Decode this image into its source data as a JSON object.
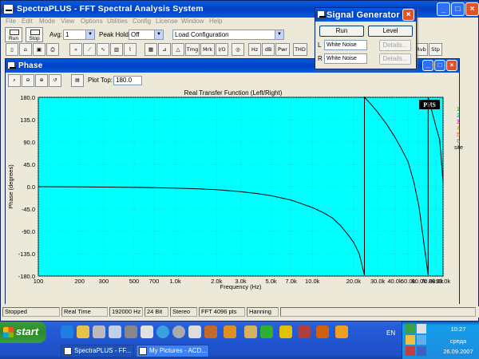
{
  "main_window": {
    "title": "SpectraPLUS - FFT Spectral Analysis System",
    "menu": [
      "File",
      "Edit",
      "Mode",
      "View",
      "Options",
      "Utilities",
      "Config",
      "License",
      "Window",
      "Help"
    ],
    "toolbar": {
      "run_label": "Run",
      "stop_label": "Stop",
      "avg_label": "Avg:",
      "avg_value": "1",
      "peak_hold_label": "Peak Hold:",
      "peak_hold_value": "Off",
      "config_value": "Load Configuration",
      "row2_buttons": [
        "Tmg",
        "Mrk",
        "I/O",
        "Hz",
        "dB",
        "Pwr",
        "THD",
        "Rvb",
        "Stp"
      ]
    }
  },
  "signal_generator": {
    "title": "Signal Generator",
    "run_label": "Run",
    "level_label": "Level",
    "left_channel_label": "L",
    "right_channel_label": "R",
    "left_signal": "White Noise",
    "right_signal": "White Noise",
    "details_label": "Details..."
  },
  "phase_window": {
    "title": "Phase",
    "plot_top_label": "Plot Top:",
    "plot_top_value": "180.0",
    "legend": {
      "numbers": [
        "1",
        "2",
        "3",
        "4",
        "5",
        "6"
      ],
      "colors": [
        "#00a000",
        "#00a0a0",
        "#a000a0",
        "#d0a000",
        "#d06000",
        "#808080"
      ],
      "trailing_text": "site"
    }
  },
  "chart_data": {
    "type": "line",
    "title": "Real Transfer Function (Left/Right)",
    "xlabel": "Frequency (Hz)",
    "ylabel": "Phase (degrees)",
    "xscale": "log",
    "xlim": [
      100,
      90000
    ],
    "ylim": [
      -180,
      180
    ],
    "x_tick_labels": [
      "100",
      "200",
      "300",
      "500",
      "700",
      "1.0k",
      "2.0k",
      "3.0k",
      "5.0k",
      "7.0k",
      "10.0k",
      "20.0k",
      "30.0k",
      "40.0k",
      "60.0k",
      "80.0k",
      "50.0k",
      "70.0k",
      "90.0k"
    ],
    "x_tick_values": [
      100,
      200,
      300,
      500,
      700,
      1000,
      2000,
      3000,
      5000,
      7000,
      10000,
      20000,
      30000,
      40000,
      60000,
      80000,
      50000,
      70000,
      90000
    ],
    "y_tick_labels": [
      "180.0",
      "135.0",
      "90.0",
      "45.0",
      "0.0",
      "-45.0",
      "-90.0",
      "-135.0",
      "-180.0"
    ],
    "y_tick_values": [
      180,
      135,
      90,
      45,
      0,
      -45,
      -90,
      -135,
      -180
    ],
    "grid": true,
    "background": "#00ffff",
    "logo_text": "PHS",
    "series": [
      {
        "color": "#000000",
        "x": [
          100,
          200,
          300,
          500,
          700,
          1000,
          1500,
          2000,
          3000,
          4000,
          5000,
          7000,
          10000,
          12000,
          14000,
          16000,
          18000,
          20000,
          22000,
          24000,
          24000,
          26000,
          30000,
          35000,
          40000,
          45000,
          50000,
          55000,
          60000,
          65000,
          70000,
          70000,
          75000,
          80000,
          85000,
          90000
        ],
        "y": [
          0,
          -0.5,
          -0.8,
          -1.5,
          -2,
          -3,
          -4.5,
          -6,
          -10,
          -14,
          -18,
          -27,
          -42,
          -52,
          -63,
          -78,
          -95,
          -112,
          -135,
          -178,
          180,
          170,
          150,
          125,
          100,
          75,
          50,
          10,
          -40,
          -110,
          -178,
          180,
          150,
          120,
          95,
          10
        ]
      }
    ]
  },
  "status_bar": {
    "cells": [
      "Stopped",
      "Real Time",
      "192000 Hz",
      "24 Bit",
      "Stereo",
      "FFT 4096 pts",
      "Hanning"
    ]
  },
  "taskbar": {
    "start_label": "start",
    "tasks": [
      {
        "label": "SpectraPLUS - FF...",
        "active": true
      },
      {
        "label": "My Pictures - ACD...",
        "active": false
      }
    ],
    "language": "EN",
    "clock_time": "10:27",
    "clock_day": "среда",
    "clock_date": "26.09.2007"
  }
}
